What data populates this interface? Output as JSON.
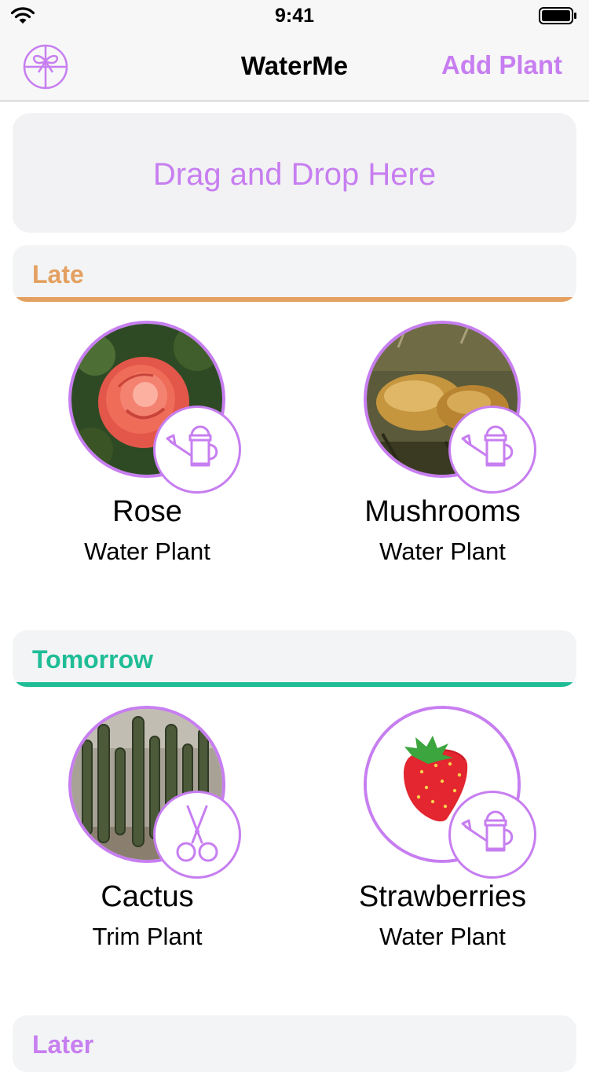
{
  "status_bar": {
    "time": "9:41"
  },
  "nav": {
    "title": "WaterMe",
    "add_button": "Add Plant",
    "left_icon": "gift-bow-icon"
  },
  "drop_zone": {
    "label": "Drag and Drop Here"
  },
  "colors": {
    "accent": "#c77ef0",
    "late": "#e3a060",
    "tomorrow": "#1fbd96",
    "later": "#c77ef0"
  },
  "sections": [
    {
      "title": "Late",
      "plants": [
        {
          "name": "Rose",
          "action": "Water Plant",
          "action_icon": "watering-can-icon",
          "photo": "rose-photo"
        },
        {
          "name": "Mushrooms",
          "action": "Water Plant",
          "action_icon": "watering-can-icon",
          "photo": "mushrooms-photo"
        }
      ]
    },
    {
      "title": "Tomorrow",
      "plants": [
        {
          "name": "Cactus",
          "action": "Trim Plant",
          "action_icon": "scissors-icon",
          "photo": "cactus-photo"
        },
        {
          "name": "Strawberries",
          "action": "Water Plant",
          "action_icon": "watering-can-icon",
          "photo": "strawberry-emoji"
        }
      ]
    },
    {
      "title": "Later",
      "plants": []
    }
  ]
}
